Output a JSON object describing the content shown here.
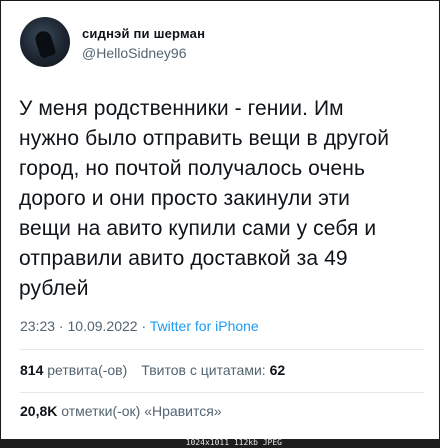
{
  "author": {
    "display_name": "сиднэй пи шерман",
    "handle": "@HelloSidney96"
  },
  "tweet": {
    "text": "У меня родственники - гении. Им\nнужно было отправить вещи в другой\nгород, но почтой получалось очень\nдорого и они просто закинули эти\nвещи на авито купили сами у себя и\nотправили авито доставкой за 49\nрублей"
  },
  "meta": {
    "time": "23:23",
    "separator": " · ",
    "date": "10.09.2022",
    "source": "Twitter for iPhone"
  },
  "stats": {
    "retweets_count": "814",
    "retweets_label": "ретвита(-ов)",
    "quotes_label": "Твитов с цитатами:",
    "quotes_count": "62",
    "likes_count": "20,8K",
    "likes_label": "отметки(-ок) «Нравится»"
  },
  "image_footer": "1024x1011 112kb JPEG"
}
